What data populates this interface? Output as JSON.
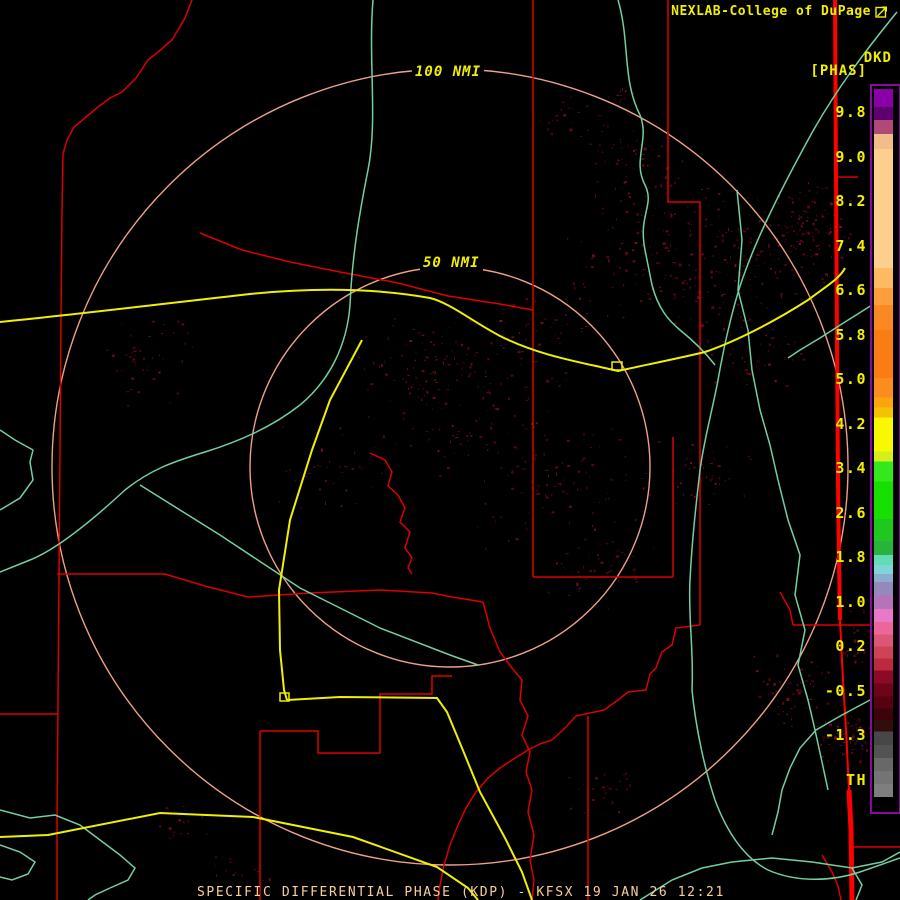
{
  "header": {
    "title": "NEXLAB-College of DuPage",
    "product_code": "DKD",
    "units_label": "[PHAS]",
    "text_color": "#f2ee00"
  },
  "colorbar": {
    "labels": [
      "9.8",
      "9.0",
      "8.2",
      "7.4",
      "6.6",
      "5.8",
      "5.0",
      "4.2",
      "3.4",
      "2.6",
      "1.8",
      "1.0",
      "0.2",
      "-0.5",
      "-1.3",
      "TH"
    ],
    "label_color": "#f2ee00",
    "border_color": "#8a0b9a",
    "bands": [
      {
        "from": 88,
        "to": 106,
        "color": "#8a00a8"
      },
      {
        "from": 106,
        "to": 119,
        "color": "#5e0070"
      },
      {
        "from": 119,
        "to": 133,
        "color": "#b04878"
      },
      {
        "from": 133,
        "to": 148,
        "color": "#f2bd88"
      },
      {
        "from": 148,
        "to": 268,
        "color": "#fdcf8e"
      },
      {
        "from": 268,
        "to": 288,
        "color": "#fdb963"
      },
      {
        "from": 288,
        "to": 305,
        "color": "#fc9e3c"
      },
      {
        "from": 305,
        "to": 330,
        "color": "#fb8820"
      },
      {
        "from": 330,
        "to": 378,
        "color": "#fa7c14"
      },
      {
        "from": 378,
        "to": 398,
        "color": "#fb8d1f"
      },
      {
        "from": 398,
        "to": 408,
        "color": "#fca40e"
      },
      {
        "from": 408,
        "to": 418,
        "color": "#f3c303"
      },
      {
        "from": 418,
        "to": 452,
        "color": "#f8f800"
      },
      {
        "from": 452,
        "to": 462,
        "color": "#d4ef1b"
      },
      {
        "from": 462,
        "to": 482,
        "color": "#35e81c"
      },
      {
        "from": 482,
        "to": 520,
        "color": "#17e000"
      },
      {
        "from": 520,
        "to": 542,
        "color": "#1fc81f"
      },
      {
        "from": 542,
        "to": 556,
        "color": "#28b43c"
      },
      {
        "from": 556,
        "to": 566,
        "color": "#63dcb4"
      },
      {
        "from": 566,
        "to": 575,
        "color": "#7fd4d8"
      },
      {
        "from": 575,
        "to": 583,
        "color": "#8cabce"
      },
      {
        "from": 583,
        "to": 596,
        "color": "#9489bd"
      },
      {
        "from": 596,
        "to": 610,
        "color": "#b573b8"
      },
      {
        "from": 610,
        "to": 623,
        "color": "#e878c8"
      },
      {
        "from": 623,
        "to": 636,
        "color": "#ee6699"
      },
      {
        "from": 636,
        "to": 648,
        "color": "#dd5577"
      },
      {
        "from": 648,
        "to": 660,
        "color": "#cc4455"
      },
      {
        "from": 660,
        "to": 672,
        "color": "#bb2a3e"
      },
      {
        "from": 672,
        "to": 685,
        "color": "#8c0a26"
      },
      {
        "from": 685,
        "to": 698,
        "color": "#6e041a"
      },
      {
        "from": 698,
        "to": 710,
        "color": "#560210"
      },
      {
        "from": 710,
        "to": 722,
        "color": "#3c040a"
      },
      {
        "from": 722,
        "to": 733,
        "color": "#2e0f0d"
      },
      {
        "from": 733,
        "to": 747,
        "color": "#474747"
      },
      {
        "from": 747,
        "to": 760,
        "color": "#535353"
      },
      {
        "from": 760,
        "to": 773,
        "color": "#686868"
      },
      {
        "from": 773,
        "to": 786,
        "color": "#747474"
      },
      {
        "from": 786,
        "to": 799,
        "color": "#7e7e7e"
      },
      {
        "from": 799,
        "to": 805,
        "color": "#000000"
      }
    ]
  },
  "map": {
    "background": "#000000",
    "range_rings": {
      "labels": [
        "100 NMI",
        "50 NMI"
      ],
      "color": "#eda287",
      "label_color": "#f2ee00"
    },
    "layer_colors": {
      "county_boundaries": "#dd0000",
      "state_boundary": "#ff0000",
      "interstate_highways": "#f0f000",
      "secondary_roads": "#74cfa0",
      "radar_echoes": [
        "#5c0a12",
        "#6e0d18",
        "#7e1020"
      ]
    }
  },
  "status_bar": {
    "text": "SPECIFIC DIFFERENTIAL PHASE (KDP) - KFSX 19 JAN 26 12:21",
    "color": "#f8cf9a"
  }
}
